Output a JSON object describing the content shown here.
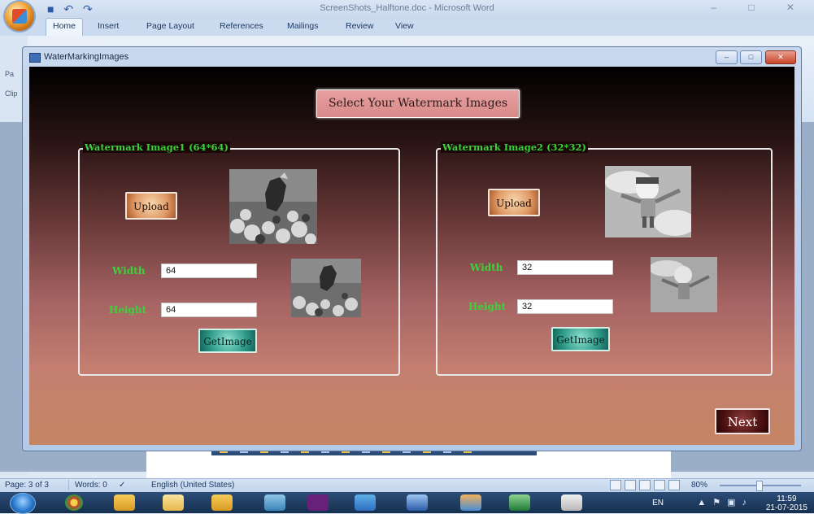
{
  "word": {
    "title": "ScreenShots_Halftone.doc - Microsoft Word",
    "quick_access": "■ ↶ ↷",
    "tabs": [
      "Home",
      "Insert",
      "Page Layout",
      "References",
      "Mailings",
      "Review",
      "View"
    ],
    "active_tab": "Home",
    "side_labels": [
      "Pa",
      "Clip"
    ],
    "window_controls": "– □ ✕"
  },
  "app": {
    "title": "WaterMarkingImages",
    "controls": {
      "minimize": "–",
      "maximize": "□",
      "close": "✕"
    },
    "heading": "Select Your Watermark Images",
    "group1": {
      "title": "Watermark Image1 (64*64)",
      "upload_label": "Upload",
      "width_label": "Width",
      "width_value": "64",
      "height_label": "Height",
      "height_value": "64",
      "get_label": "GetImage"
    },
    "group2": {
      "title": "Watermark Image2 (32*32)",
      "upload_label": "Upload",
      "width_label": "Width",
      "width_value": "32",
      "height_label": "Height",
      "height_value": "32",
      "get_label": "GetImage"
    },
    "next_label": "Next"
  },
  "status_bar": {
    "page": "Page: 3 of 3",
    "words": "Words: 0",
    "language": "English (United States)",
    "zoom": "80%"
  },
  "taskbar": {
    "language": "EN",
    "time": "11:59",
    "date": "21-07-2015"
  }
}
